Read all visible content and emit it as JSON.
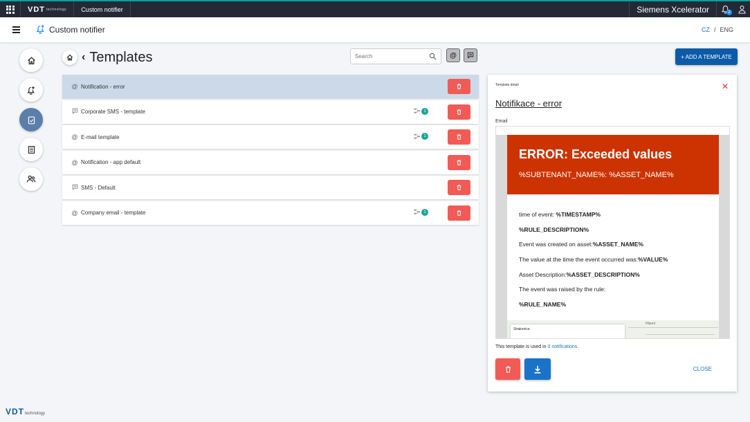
{
  "topbar": {
    "brand": "VDT",
    "brand_sub": "technology",
    "app_name": "Custom notifier",
    "platform": "Siemens Xcelerator",
    "notifications_count": "2"
  },
  "header": {
    "app_title": "Custom notifier",
    "lang_cz": "CZ",
    "lang_sep": "/",
    "lang_eng": "ENG"
  },
  "page": {
    "title": "Templates",
    "search_placeholder": "Search",
    "add_button": "+ ADD A TEMPLATE"
  },
  "templates": [
    {
      "type": "email",
      "icon": "at-icon",
      "name": "Notification - error",
      "used": null,
      "selected": true
    },
    {
      "type": "sms",
      "icon": "message-icon",
      "name": "Corporate SMS - template",
      "used": "1"
    },
    {
      "type": "email",
      "icon": "at-icon",
      "name": "E-mail template",
      "used": "1"
    },
    {
      "type": "email",
      "icon": "at-icon",
      "name": "Notification - app default",
      "used": null
    },
    {
      "type": "sms",
      "icon": "message-icon",
      "name": "SMS - Default",
      "used": null
    },
    {
      "type": "email",
      "icon": "at-icon",
      "name": "Company email - template",
      "used": "1"
    }
  ],
  "detail": {
    "small_label": "Template detail",
    "name": "Notifikace - error",
    "type_label": "Email",
    "preview": {
      "heading": "ERROR: Exceeded values",
      "subheading": "%SUBTENANT_NAME%: %ASSET_NAME%",
      "lines": [
        {
          "prefix": "time of event: ",
          "bold": "%TIMESTAMP%"
        },
        {
          "prefix": "",
          "bold": "%RULE_DESCRIPTION%"
        },
        {
          "prefix": "Event was created on asset:",
          "bold": "%ASSET_NAME%"
        },
        {
          "prefix": "The value at the time the event occurred was:",
          "bold": "%VALUE%"
        },
        {
          "prefix": "Asset Description:",
          "bold": "%ASSET_DESCRIPTION%"
        },
        {
          "prefix": "The event was raised by the rule:",
          "bold": ""
        },
        {
          "prefix": "",
          "bold": "%RULE_NAME%"
        }
      ],
      "map_card_text": "Strakonice",
      "map_place": "Hlavní"
    },
    "used_in_prefix": "This template is used in ",
    "used_in_link": "0 notifications.",
    "close_label": "CLOSE"
  },
  "footer": {
    "brand": "VDT",
    "brand_sub": "technology"
  },
  "colors": {
    "accent": "#0d5ba8",
    "danger": "#f15a55",
    "error_header": "#cc3300",
    "selected_row": "#ccd9e8",
    "badge": "#1aa39a"
  }
}
